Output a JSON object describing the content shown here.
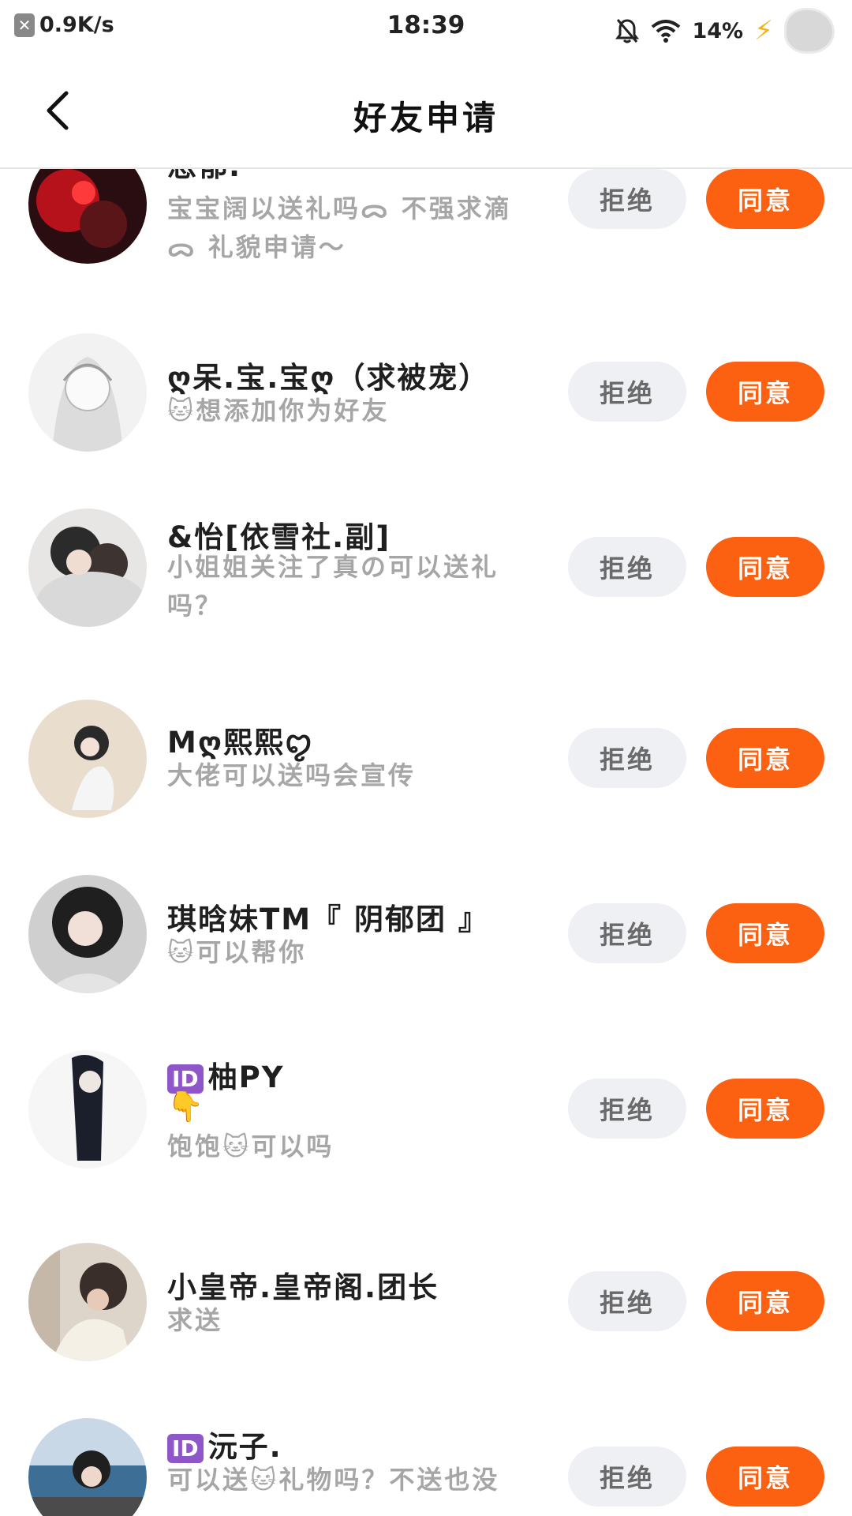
{
  "status_bar": {
    "net_speed": "0.9K/s",
    "net_icon": "x-square-icon",
    "time": "18:39",
    "battery": "14%",
    "icons": [
      "bell-off-icon",
      "wifi-icon",
      "charging-bolt-icon",
      "avatar-blob-icon"
    ]
  },
  "header": {
    "back_icon": "chevron-left-icon",
    "title": "好友申请"
  },
  "buttons": {
    "reject": "拒绝",
    "accept": "同意"
  },
  "colors": {
    "accept_bg": "#fb6111",
    "reject_bg": "#eef0f4",
    "reject_text": "#6a6a6a",
    "message_text": "#a6a6a6"
  },
  "requests": [
    {
      "badge": "",
      "name": "悲郁.",
      "extra": "",
      "message": "宝宝阔以送礼吗ᯅ 不强求滴ᯅ 礼貌申请～",
      "reject": "拒绝",
      "accept": "同意"
    },
    {
      "badge": "",
      "name": "ღ呆.宝.宝ღ（求被宠）",
      "extra": "",
      "message": "🐱想添加你为好友",
      "reject": "拒绝",
      "accept": "同意"
    },
    {
      "badge": "",
      "name": "&怡[依雪社.副]",
      "extra": "",
      "message": "小姐姐关注了真の可以送礼吗？",
      "reject": "拒绝",
      "accept": "同意"
    },
    {
      "badge": "",
      "name": "Mღ熙熙ꨄ",
      "extra": "",
      "message": "大佬可以送吗会宣传",
      "reject": "拒绝",
      "accept": "同意"
    },
    {
      "badge": "",
      "name": "琪晗妹TM『 阴郁团 』",
      "extra": "",
      "message": "🐱可以帮你",
      "reject": "拒绝",
      "accept": "同意"
    },
    {
      "badge": "ID",
      "name": "柚PY",
      "extra": "👇",
      "message": "饱饱🐱可以吗",
      "reject": "拒绝",
      "accept": "同意"
    },
    {
      "badge": "",
      "name": "小皇帝.皇帝阁.团长",
      "extra": "",
      "message": "求送",
      "reject": "拒绝",
      "accept": "同意"
    },
    {
      "badge": "ID",
      "name": "沅子.",
      "extra": "",
      "message": "可以送🐱礼物吗？不送也没",
      "reject": "拒绝",
      "accept": "同意"
    }
  ]
}
